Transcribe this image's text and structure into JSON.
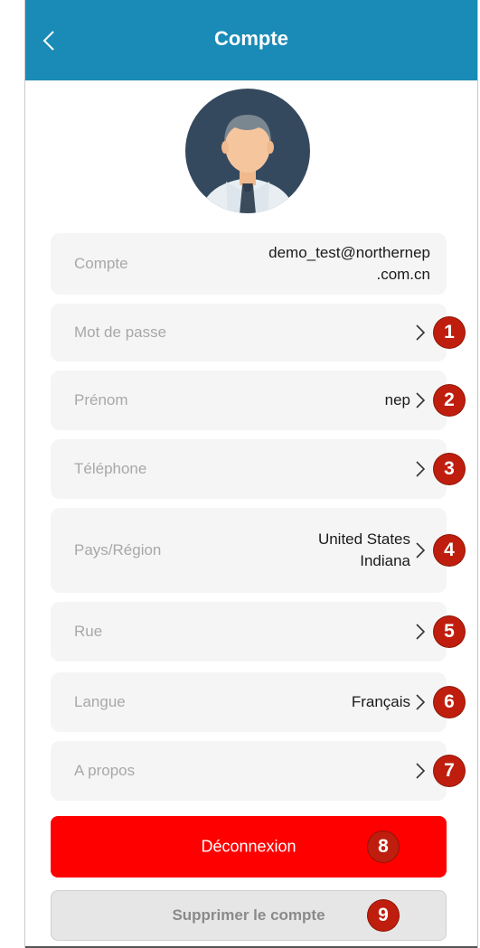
{
  "header": {
    "title": "Compte",
    "back_icon": "chevron-left-icon",
    "background_color": "#1a8bb6"
  },
  "rows": {
    "account": {
      "label": "Compte",
      "value_line1": "demo_test@northernep",
      "value_line2": ".com.cn"
    },
    "password": {
      "label": "Mot de passe",
      "badge": "1"
    },
    "first_name": {
      "label": "Prénom",
      "value": "nep",
      "badge": "2"
    },
    "phone": {
      "label": "Téléphone",
      "badge": "3"
    },
    "country": {
      "label": "Pays/Région",
      "value_line1": "United States",
      "value_line2": "Indiana",
      "badge": "4"
    },
    "street": {
      "label": "Rue",
      "badge": "5"
    },
    "language": {
      "label": "Langue",
      "value": "Français",
      "badge": "6"
    },
    "about": {
      "label": "A propos",
      "badge": "7"
    }
  },
  "buttons": {
    "logout": {
      "label": "Déconnexion",
      "badge": "8",
      "color": "#ff0000"
    },
    "delete_account": {
      "label": "Supprimer le compte",
      "badge": "9"
    }
  },
  "badge_color": "#bf1e0e"
}
